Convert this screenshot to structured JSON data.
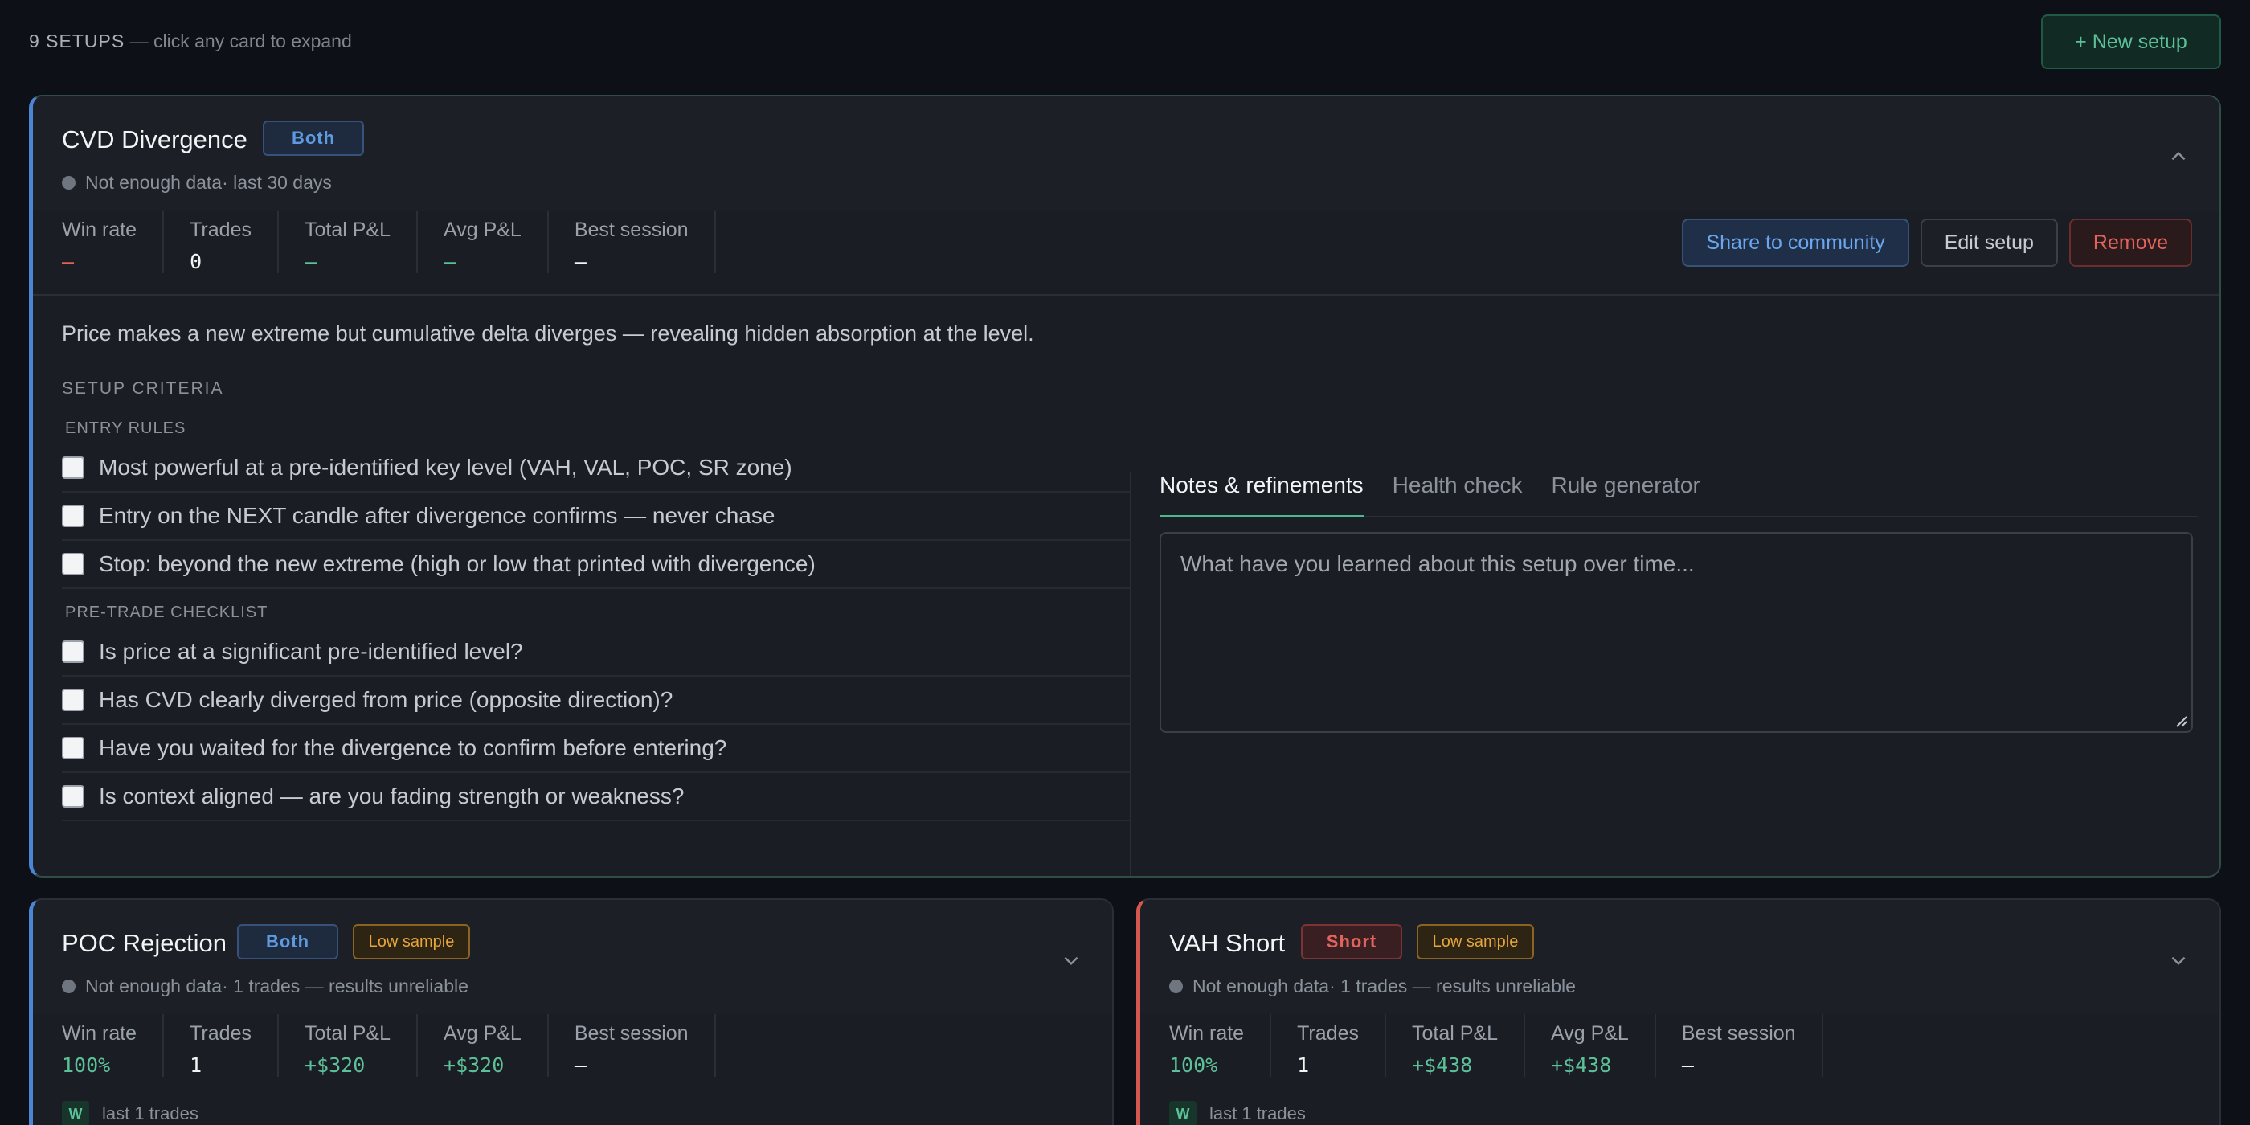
{
  "topbar": {
    "count_label": "9 SETUPS",
    "hint": " — click any card to expand",
    "new_setup_label": "+ New setup"
  },
  "stat_labels": {
    "win_rate": "Win rate",
    "trades": "Trades",
    "total_pnl": "Total P&L",
    "avg_pnl": "Avg P&L",
    "best_session": "Best session"
  },
  "cards": {
    "cvd": {
      "title": "CVD Divergence",
      "direction": "Both",
      "status": "Not enough data",
      "period": " · last 30 days",
      "stats": {
        "win_rate": "–",
        "trades": "0",
        "total_pnl": "–",
        "avg_pnl": "–",
        "best_session": "–"
      },
      "actions": {
        "share": "Share to community",
        "edit": "Edit setup",
        "remove": "Remove"
      },
      "description": "Price makes a new extreme but cumulative delta diverges — revealing hidden absorption at the level.",
      "criteria_label": "SETUP CRITERIA",
      "entry_rules_label": "ENTRY RULES",
      "entry_rules": [
        "Most powerful at a pre-identified key level (VAH, VAL, POC, SR zone)",
        "Entry on the NEXT candle after divergence confirms — never chase",
        "Stop: beyond the new extreme (high or low that printed with divergence)"
      ],
      "checklist_label": "PRE-TRADE CHECKLIST",
      "checklist": [
        "Is price at a significant pre-identified level?",
        "Has CVD clearly diverged from price (opposite direction)?",
        "Have you waited for the divergence to confirm before entering?",
        "Is context aligned — are you fading strength or weakness?"
      ],
      "tabs": [
        "Notes & refinements",
        "Health check",
        "Rule generator"
      ],
      "notes_placeholder": "What have you learned about this setup over time..."
    },
    "poc": {
      "title": "POC Rejection",
      "direction": "Both",
      "sample_badge": "Low sample",
      "status": "Not enough data",
      "period": " · 1 trades — results unreliable",
      "stats": {
        "win_rate": "100%",
        "trades": "1",
        "total_pnl": "+$320",
        "avg_pnl": "+$320",
        "best_session": "–"
      },
      "recent_chip": "W",
      "recent_label": "last 1 trades"
    },
    "vah": {
      "title": "VAH Short",
      "direction": "Short",
      "sample_badge": "Low sample",
      "status": "Not enough data",
      "period": " · 1 trades — results unreliable",
      "stats": {
        "win_rate": "100%",
        "trades": "1",
        "total_pnl": "+$438",
        "avg_pnl": "+$438",
        "best_session": "–"
      },
      "recent_chip": "W",
      "recent_label": "last 1 trades"
    }
  },
  "colors": {
    "background": "#0d1117",
    "card": "#1a1d23",
    "accent_blue": "#4c84d6",
    "accent_red": "#d4584f",
    "green": "#5cc198",
    "red": "#e0645c",
    "amber": "#e6a63a"
  },
  "icons": [
    "chevron-up-icon",
    "chevron-down-icon",
    "status-dot-icon",
    "resize-handle-icon"
  ]
}
